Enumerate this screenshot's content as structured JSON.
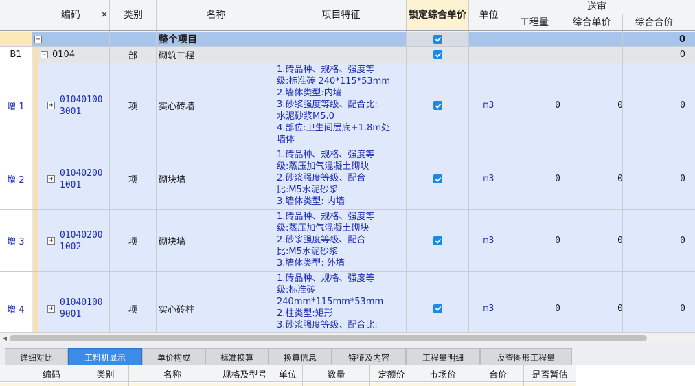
{
  "header": {
    "code": "编码",
    "close_mark": "×",
    "category": "类别",
    "name": "名称",
    "features": "项目特征",
    "lock_price": "锁定综合单价",
    "unit": "单位",
    "review": "送审",
    "quantity": "工程量",
    "unit_price": "综合单价",
    "total_price": "综合合价"
  },
  "rows": {
    "root": {
      "name": "整个项目",
      "total": "0",
      "locked": true
    },
    "b1": {
      "index": "B1",
      "code": "0104",
      "category": "部",
      "name": "砌筑工程",
      "total": "0",
      "locked": true
    },
    "items": [
      {
        "index": "增 1",
        "code1": "01040100",
        "code2": "3001",
        "category": "项",
        "name": "实心砖墙",
        "features": "1.砖品种、规格、强度等\n级:标准砖 240*115*53mm\n2.墙体类型:内墙\n3.砂浆强度等级、配合比:\n水泥砂浆M5.0\n4.部位:卫生间层底+1.8m处\n墙体",
        "unit": "m3",
        "quantity": "0",
        "unit_price": "0",
        "total": "0",
        "locked": true
      },
      {
        "index": "增 2",
        "code1": "01040200",
        "code2": "1001",
        "category": "项",
        "name": "砌块墙",
        "features": "1.砖品种、规格、强度等\n级:蒸压加气混凝土砌块\n2.砂浆强度等级、配合\n比:M5水泥砂浆\n3.墙体类型: 内墙",
        "unit": "m3",
        "quantity": "0",
        "unit_price": "0",
        "total": "0",
        "locked": true
      },
      {
        "index": "增 3",
        "code1": "01040200",
        "code2": "1002",
        "category": "项",
        "name": "砌块墙",
        "features": "1.砖品种、规格、强度等\n级:蒸压加气混凝土砌块\n2.砂浆强度等级、配合\n比:M5水泥砂浆\n3.墙体类型: 外墙",
        "unit": "m3",
        "quantity": "0",
        "unit_price": "0",
        "total": "0",
        "locked": true
      },
      {
        "index": "增 4",
        "code1": "01040100",
        "code2": "9001",
        "category": "项",
        "name": "实心砖柱",
        "features": "1.砖品种、规格、强度等\n级:标准砖\n240mm*115mm*53mm\n2.柱类型:矩形\n3.砂浆强度等级、配合比:",
        "unit": "m3",
        "quantity": "0",
        "unit_price": "0",
        "total": "0",
        "locked": true
      }
    ]
  },
  "tabs": [
    "详细对比",
    "工料机显示",
    "单价构成",
    "标准换算",
    "换算信息",
    "特征及内容",
    "工程量明细",
    "反查图形工程量"
  ],
  "active_tab": "工料机显示",
  "bottom_headers": [
    "编码",
    "类别",
    "名称",
    "规格及型号",
    "单位",
    "数量",
    "定额价",
    "市场价",
    "合价",
    "是否暂估"
  ],
  "colors": {
    "accent": "#3b8be8",
    "row_blue": "#dfe9fb",
    "lock_header": "#fdf3d3",
    "code_text": "#1c2bb5"
  }
}
